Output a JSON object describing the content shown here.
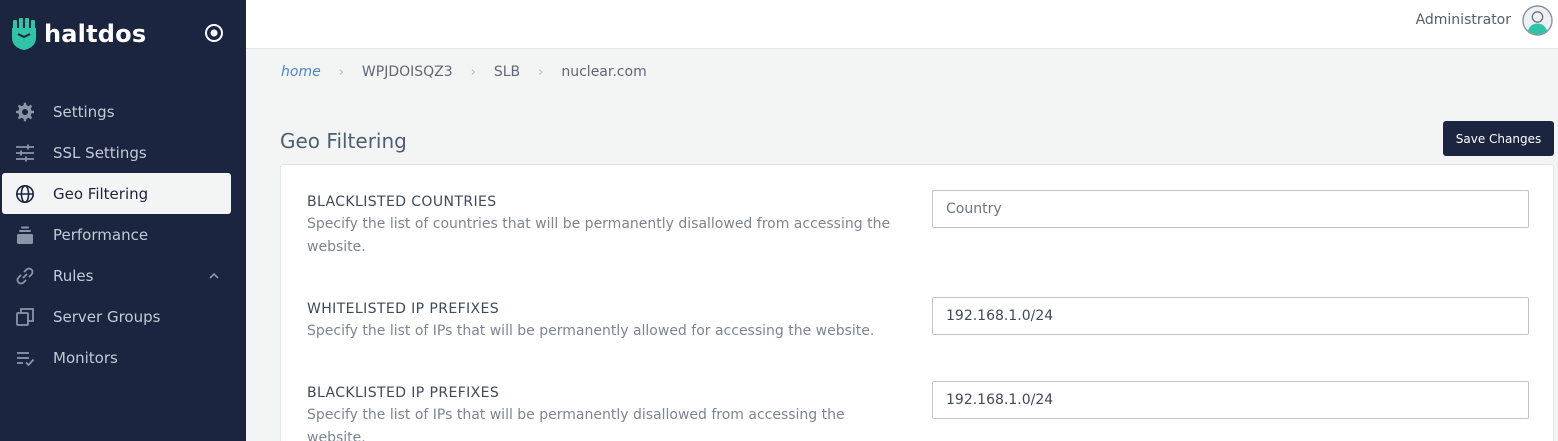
{
  "brand": {
    "name": "haltdos"
  },
  "sidebar": {
    "items": [
      {
        "label": "Settings",
        "icon": "gear-icon"
      },
      {
        "label": "SSL Settings",
        "icon": "sliders-icon"
      },
      {
        "label": "Geo Filtering",
        "icon": "globe-icon",
        "active": true
      },
      {
        "label": "Performance",
        "icon": "stack-icon"
      },
      {
        "label": "Rules",
        "icon": "link-icon",
        "expandable": true
      },
      {
        "label": "Server Groups",
        "icon": "server-groups-icon"
      },
      {
        "label": "Monitors",
        "icon": "monitor-list-icon"
      }
    ]
  },
  "topbar": {
    "user_name": "Administrator"
  },
  "breadcrumb": {
    "home": "home",
    "items": [
      "WPJDOISQZ3",
      "SLB",
      "nuclear.com"
    ]
  },
  "page": {
    "title": "Geo Filtering",
    "save_label": "Save Changes"
  },
  "fields": [
    {
      "title": "BLACKLISTED COUNTRIES",
      "description": "Specify the list of countries that will be permanently disallowed from accessing the website.",
      "value": "",
      "placeholder": "Country"
    },
    {
      "title": "WHITELISTED IP PREFIXES",
      "description": "Specify the list of IPs that will be permanently allowed for accessing the website.",
      "value": "192.168.1.0/24",
      "placeholder": ""
    },
    {
      "title": "BLACKLISTED IP PREFIXES",
      "description": "Specify the list of IPs that will be permanently disallowed from accessing the website.",
      "value": "192.168.1.0/24",
      "placeholder": ""
    }
  ],
  "colors": {
    "sidebar_bg": "#1b2540",
    "accent_link": "#4b86c9",
    "brand_logo": "#2fc4a8",
    "page_bg": "#f3f4f4"
  }
}
